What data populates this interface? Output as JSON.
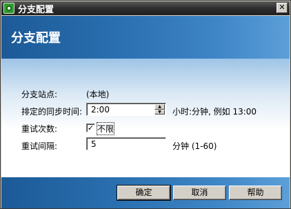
{
  "window": {
    "title": "分支配置",
    "close_glyph": "✕"
  },
  "header": {
    "title": "分支配置"
  },
  "form": {
    "branch_site_label": "分支站点:",
    "branch_site_value": "(本地)",
    "sync_time_label": "排定的同步时间:",
    "sync_time_value": "2:00",
    "sync_time_hint": "小时:分钟, 例如 13:00",
    "retry_count_label": "重试次数:",
    "retry_unlimited_checked": true,
    "retry_unlimited_label": "不限",
    "retry_interval_label": "重试间隔:",
    "retry_interval_value": "5",
    "retry_interval_hint": "分钟 (1-60)"
  },
  "buttons": {
    "ok": "确定",
    "cancel": "取消",
    "help": "帮助"
  },
  "icons": {
    "app": "app-icon",
    "close": "close-icon",
    "spin_up": "spin-up-icon",
    "spin_down": "spin-down-icon",
    "check": "checkmark-icon"
  },
  "colors": {
    "header_dark": "#1c5a97",
    "header_light": "#5c9fd8",
    "titlebar": "#2e2e2e",
    "dialog_bg": "#d4d0c8"
  }
}
